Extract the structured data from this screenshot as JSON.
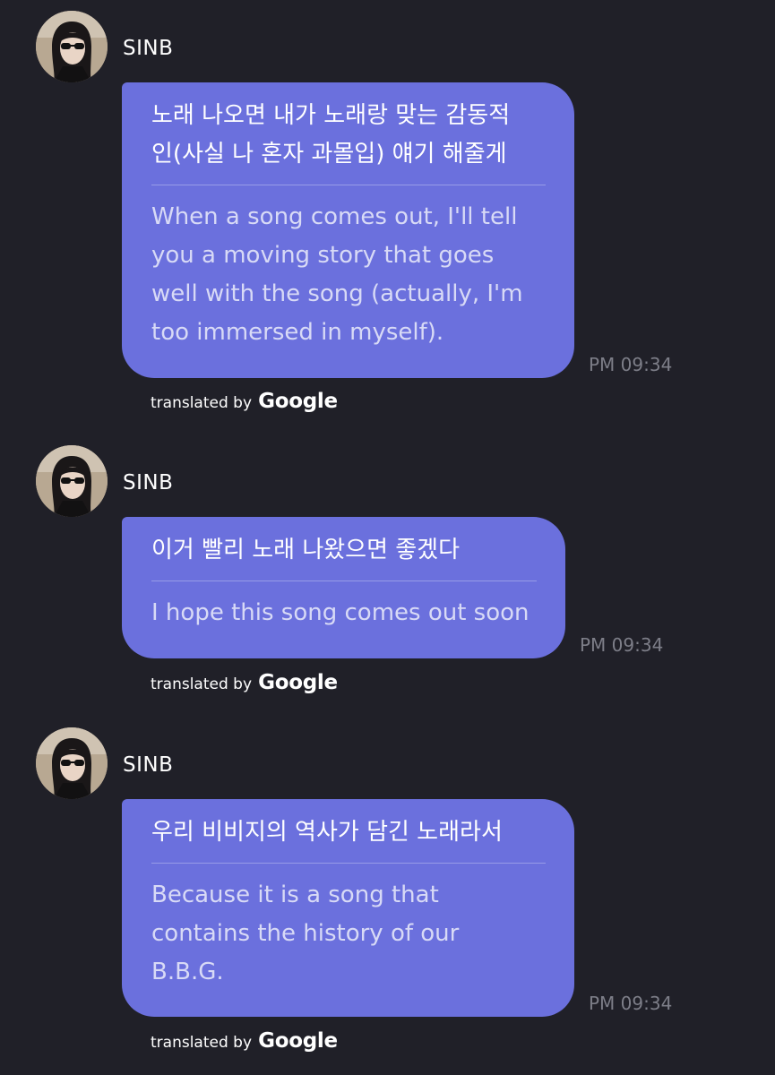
{
  "messages": [
    {
      "sender": "SINB",
      "original": "노래 나오면 내가 노래랑 맞는 감동적\n인(사실 나 혼자 과몰입) 얘기 해줄게",
      "translation": "When a song comes out, I'll tell\nyou a moving story that goes\nwell with the song (actually, I'm\ntoo immersed in myself).",
      "time": "PM 09:34",
      "translated_by": "translated by",
      "translator": "Google"
    },
    {
      "sender": "SINB",
      "original": "이거 빨리 노래 나왔으면 좋겠다",
      "translation": "I hope this song comes out soon",
      "time": "PM 09:34",
      "translated_by": "translated by",
      "translator": "Google"
    },
    {
      "sender": "SINB",
      "original": "우리 비비지의 역사가 담긴 노래라서",
      "translation": "Because it is a song that\ncontains the history of our\nB.B.G.",
      "time": "PM 09:34",
      "translated_by": "translated by",
      "translator": "Google"
    }
  ],
  "colors": {
    "background": "#202028",
    "bubble": "#6b70dd",
    "timestamp": "#7d7e88"
  },
  "icons": {
    "avatar": "profile-photo-avatar"
  }
}
